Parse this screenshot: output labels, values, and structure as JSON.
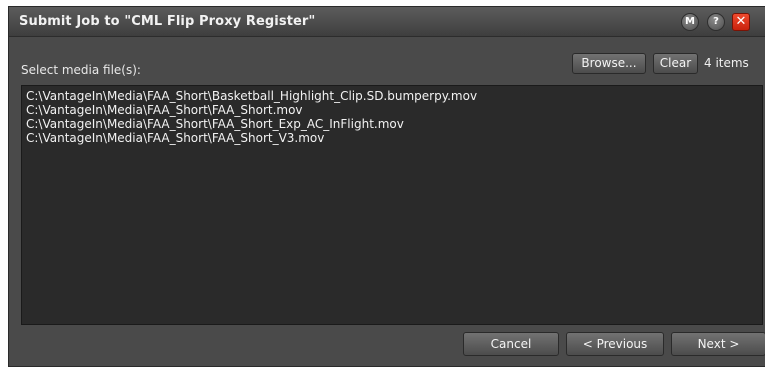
{
  "dialog": {
    "title": "Submit Job to \"CML Flip Proxy Register\"",
    "window_buttons": {
      "m_label": "M",
      "help_label": "?",
      "close_label": "✕"
    }
  },
  "media": {
    "select_label": "Select media file(s):",
    "browse_label": "Browse...",
    "clear_label": "Clear",
    "count_label": "4 items",
    "files": [
      "C:\\VantageIn\\Media\\FAA_Short\\Basketball_Highlight_Clip.SD.bumperpy.mov",
      "C:\\VantageIn\\Media\\FAA_Short\\FAA_Short.mov",
      "C:\\VantageIn\\Media\\FAA_Short\\FAA_Short_Exp_AC_InFlight.mov",
      "C:\\VantageIn\\Media\\FAA_Short\\FAA_Short_V3.mov"
    ]
  },
  "footer": {
    "cancel_label": "Cancel",
    "previous_label": "< Previous",
    "next_label": "Next >"
  },
  "colors": {
    "dialog_bg": "#4a4a4a",
    "list_bg": "#2a2a2a",
    "close_red": "#e03418",
    "text": "#f2f2f2"
  }
}
